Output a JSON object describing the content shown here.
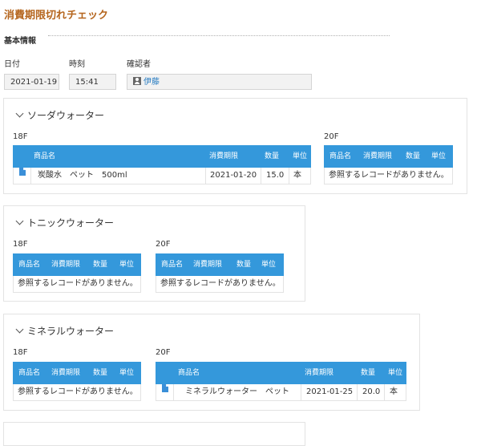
{
  "page": {
    "title": "消費期限切れチェック"
  },
  "basic_info": {
    "section_label": "基本情報",
    "date": {
      "label": "日付",
      "value": "2021-01-19"
    },
    "time": {
      "label": "時刻",
      "value": "15:41"
    },
    "checker": {
      "label": "確認者",
      "value": "伊藤"
    }
  },
  "columns": {
    "name": "商品名",
    "expiry": "消費期限",
    "qty": "数量",
    "unit": "単位"
  },
  "empty_message": "参照するレコードがありません。",
  "groups": [
    {
      "title": "ソーダウォーター",
      "floors": [
        {
          "label": "18F",
          "rows": [
            {
              "name": "炭酸水　ペット　500ml",
              "expiry": "2021-01-20",
              "qty": "15.0",
              "unit": "本"
            }
          ]
        },
        {
          "label": "20F",
          "rows": []
        }
      ]
    },
    {
      "title": "トニックウォーター",
      "floors": [
        {
          "label": "18F",
          "rows": []
        },
        {
          "label": "20F",
          "rows": []
        }
      ]
    },
    {
      "title": "ミネラルウォーター",
      "floors": [
        {
          "label": "18F",
          "rows": []
        },
        {
          "label": "20F",
          "rows": [
            {
              "name": "ミネラルウォーター　ペット",
              "expiry": "2021-01-25",
              "qty": "20.0",
              "unit": "本"
            }
          ]
        }
      ]
    }
  ]
}
